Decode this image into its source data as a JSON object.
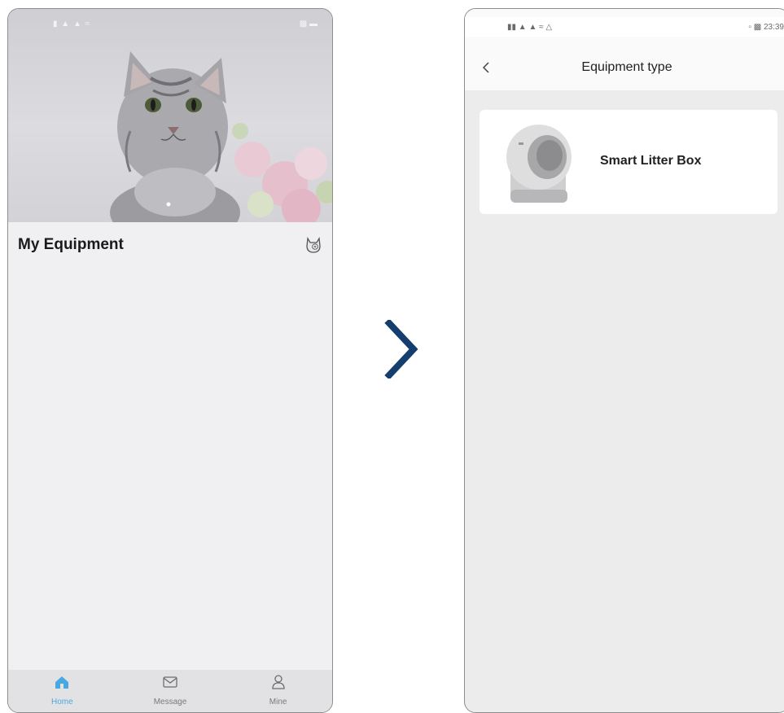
{
  "left_screen": {
    "section_title": "My Equipment",
    "tabs": [
      {
        "label": "Home",
        "icon": "home-icon",
        "active": true
      },
      {
        "label": "Message",
        "icon": "envelope-icon",
        "active": false
      },
      {
        "label": "Mine",
        "icon": "person-icon",
        "active": false
      }
    ],
    "accent_color": "#4aa8e0"
  },
  "right_screen": {
    "status_time": "23:39",
    "page_title": "Equipment type",
    "items": [
      {
        "label": "Smart Litter Box",
        "icon": "litter-box-image"
      }
    ]
  },
  "arrow_color": "#143e6e"
}
